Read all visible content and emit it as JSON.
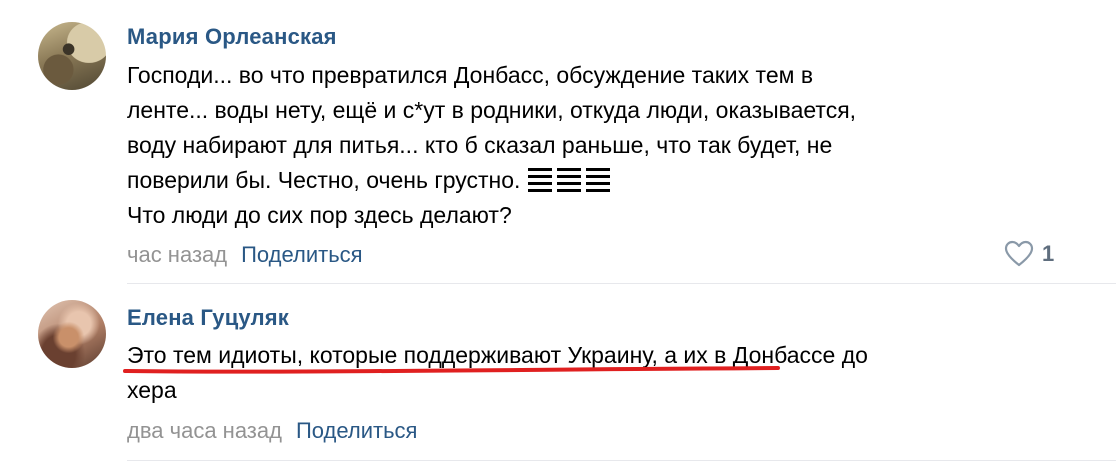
{
  "comments": [
    {
      "author": "Мария Орлеанская",
      "lines": [
        "Господи... во что превратился Донбасс, обсуждение таких тем в",
        "ленте... воды нету, ещё и с*ут в родники, откуда люди, оказывается,",
        "воду набирают для питья... кто б сказал раньше, что так будет, не",
        "поверили бы. Честно, очень грустно.",
        "Что люди до сих пор здесь делают?"
      ],
      "time": "час назад",
      "share_label": "Поделиться",
      "likes": "1"
    },
    {
      "author": "Елена Гуцуляк",
      "lines": [
        "Это тем идиоты, которые поддерживают Украину, а их в Донбассе до",
        "хера"
      ],
      "time": "два часа назад",
      "share_label": "Поделиться"
    }
  ],
  "colors": {
    "author": "#2a5885",
    "meta": "#939393",
    "underline": "#e02020"
  }
}
